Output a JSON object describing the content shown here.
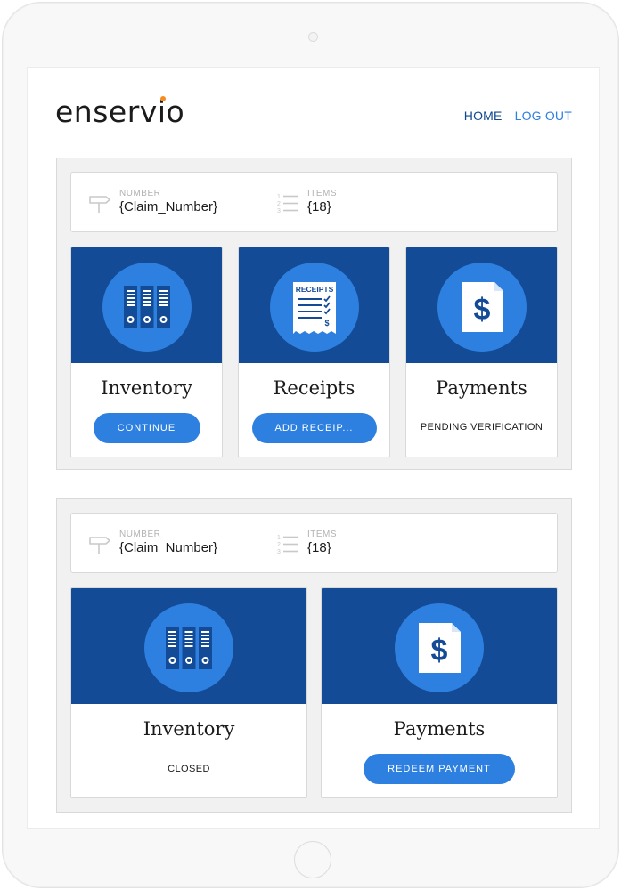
{
  "app": {
    "logo_text_before": "enserv",
    "logo_i": "i",
    "logo_text_after": "o",
    "accent_orange": "#f68b1f",
    "brand_blue": "#134b96",
    "button_blue": "#2e80e0"
  },
  "nav": {
    "home": "HOME",
    "logout": "LOG OUT"
  },
  "claims": [
    {
      "number_label": "NUMBER",
      "number_value": "{Claim_Number}",
      "items_label": "ITEMS",
      "items_value": "{18}",
      "cards": [
        {
          "icon": "binders-icon",
          "title": "Inventory",
          "button": "CONTINUE"
        },
        {
          "icon": "receipt-icon",
          "icon_text": "RECEIPTS",
          "title": "Receipts",
          "button": "ADD RECEIP..."
        },
        {
          "icon": "dollar-document-icon",
          "title": "Payments",
          "status": "PENDING VERIFICATION"
        }
      ]
    },
    {
      "number_label": "NUMBER",
      "number_value": "{Claim_Number}",
      "items_label": "ITEMS",
      "items_value": "{18}",
      "cards": [
        {
          "icon": "binders-icon",
          "title": "Inventory",
          "status": "CLOSED"
        },
        {
          "icon": "dollar-document-icon",
          "title": "Payments",
          "button": "REDEEM PAYMENT"
        }
      ]
    }
  ]
}
